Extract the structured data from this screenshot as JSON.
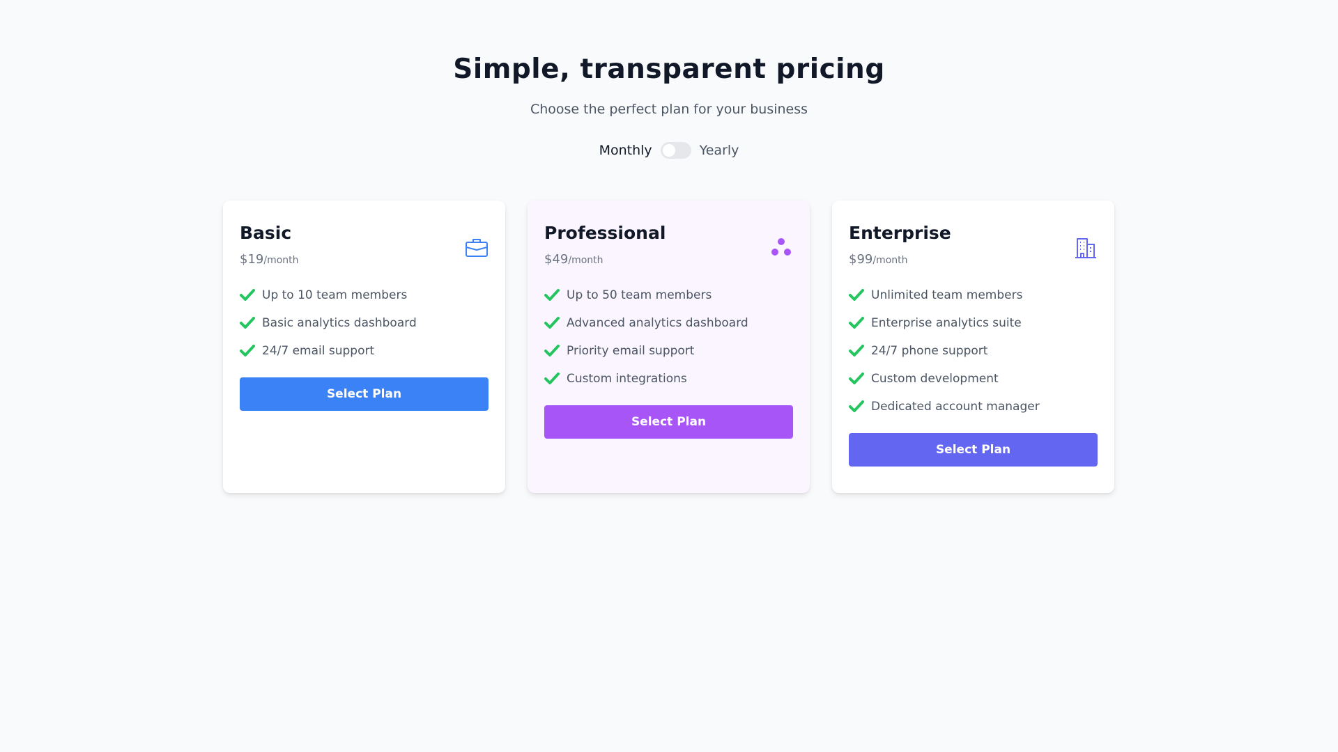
{
  "header": {
    "title": "Simple, transparent pricing",
    "subtitle": "Choose the perfect plan for your business"
  },
  "billing": {
    "monthly_label": "Monthly",
    "yearly_label": "Yearly",
    "selected": "Monthly"
  },
  "plans": [
    {
      "name": "Basic",
      "price": "$19",
      "period": "/month",
      "icon": "briefcase-icon",
      "accent": "#3b82f6",
      "features": [
        "Up to 10 team members",
        "Basic analytics dashboard",
        "24/7 email support"
      ],
      "button_label": "Select Plan"
    },
    {
      "name": "Professional",
      "price": "$49",
      "period": "/month",
      "icon": "three-dots-icon",
      "accent": "#a855f7",
      "features": [
        "Up to 50 team members",
        "Advanced analytics dashboard",
        "Priority email support",
        "Custom integrations"
      ],
      "button_label": "Select Plan"
    },
    {
      "name": "Enterprise",
      "price": "$99",
      "period": "/month",
      "icon": "building-icon",
      "accent": "#6366f1",
      "features": [
        "Unlimited team members",
        "Enterprise analytics suite",
        "24/7 phone support",
        "Custom development",
        "Dedicated account manager"
      ],
      "button_label": "Select Plan"
    }
  ],
  "colors": {
    "check": "#22c55e",
    "background": "#f9fafb"
  }
}
